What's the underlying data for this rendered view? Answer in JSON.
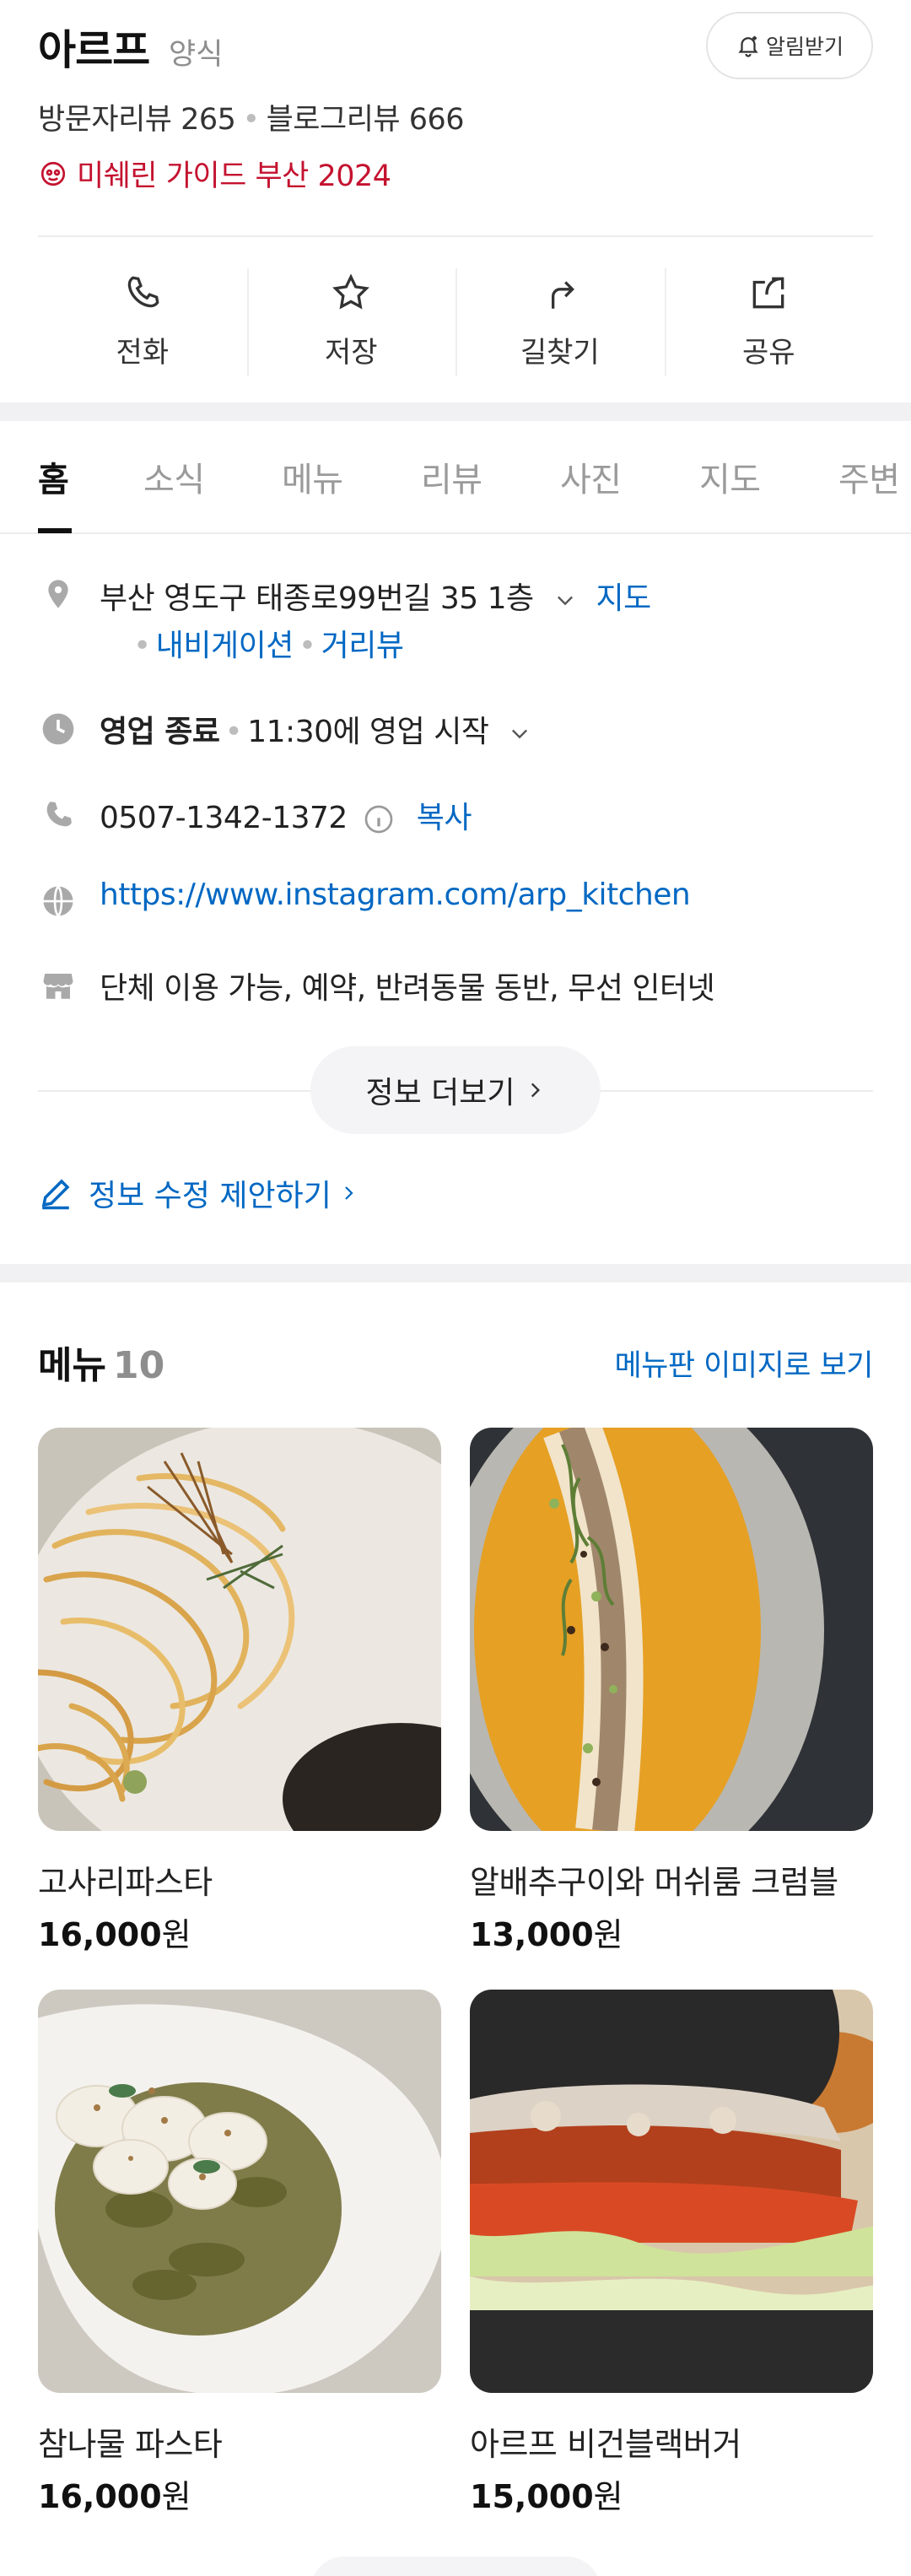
{
  "place": {
    "name": "아르프",
    "category": "양식",
    "alarm_label": "알림받기",
    "visitor_reviews": "방문자리뷰 265",
    "blog_reviews": "블로그리뷰 666",
    "michelin": "미쉐린 가이드 부산 2024"
  },
  "actions": [
    {
      "label": "전화",
      "icon": "phone-icon"
    },
    {
      "label": "저장",
      "icon": "star-icon"
    },
    {
      "label": "길찾기",
      "icon": "directions-icon"
    },
    {
      "label": "공유",
      "icon": "share-icon"
    }
  ],
  "tabs": [
    "홈",
    "소식",
    "메뉴",
    "리뷰",
    "사진",
    "지도",
    "주변"
  ],
  "active_tab": "홈",
  "info": {
    "address": "부산 영도구 태종로99번길 35 1층",
    "map_link": "지도",
    "navigation_link": "내비게이션",
    "street_view_link": "거리뷰",
    "hours_status": "영업 종료",
    "hours_next": "11:30에 영업 시작",
    "phone": "0507-1342-1372",
    "copy_label": "복사",
    "website": "https://www.instagram.com/arp_kitchen",
    "amenities": "단체 이용 가능, 예약, 반려동물 동반, 무선 인터넷",
    "more_label": "정보 더보기",
    "edit_suggest": "정보 수정 제안하기"
  },
  "menu": {
    "title": "메뉴",
    "count": "10",
    "image_link": "메뉴판 이미지로 보기",
    "items": [
      {
        "name": "고사리파스타",
        "price": "16,000",
        "unit": "원"
      },
      {
        "name": "알배추구이와 머쉬룸 크럼블",
        "price": "13,000",
        "unit": "원"
      },
      {
        "name": "참나물 파스타",
        "price": "16,000",
        "unit": "원"
      },
      {
        "name": "아르프 비건블랙버거",
        "price": "15,000",
        "unit": "원"
      }
    ]
  },
  "colors": {
    "link": "#0068c3",
    "michelin": "#c4122f",
    "divider": "#f1f1f3"
  }
}
